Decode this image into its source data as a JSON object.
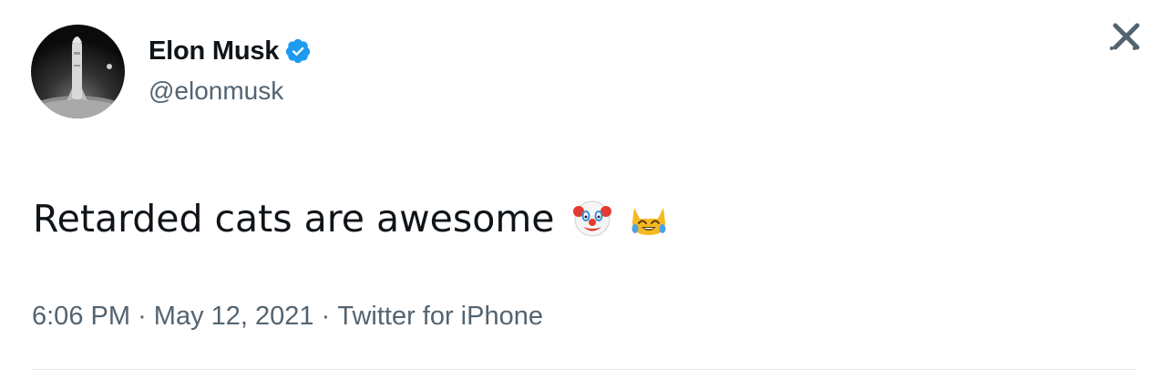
{
  "tweet": {
    "author": {
      "display_name": "Elon Musk",
      "handle": "@elonmusk",
      "verified": true,
      "avatar_icon": "rocket-on-moon-avatar"
    },
    "text": "Retarded cats are awesome",
    "emojis": [
      "clown-face-emoji",
      "cat-tears-of-joy-emoji"
    ],
    "time": "6:06 PM",
    "date": "May 12, 2021",
    "source": "Twitter for iPhone",
    "separator": "·",
    "close_icon": "close-icon"
  },
  "colors": {
    "text_primary": "#0f1419",
    "text_secondary": "#536471",
    "verified_blue": "#1d9bf0",
    "divider": "#e7e9ea"
  }
}
